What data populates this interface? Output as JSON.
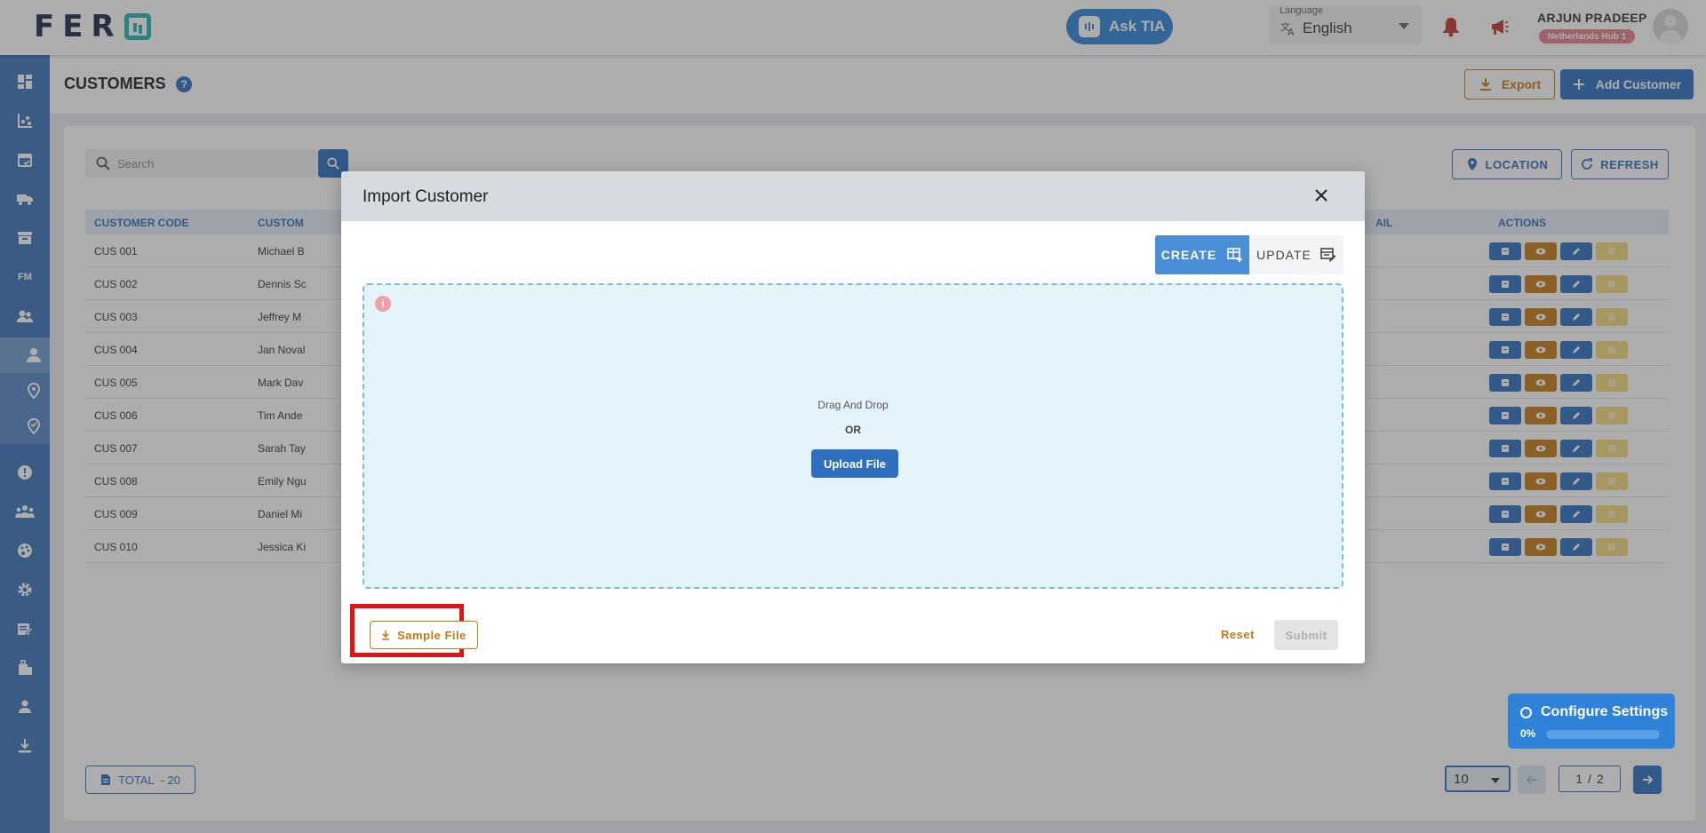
{
  "topbar": {
    "logo_text": "FER",
    "ask_tia_label": "Ask TIA",
    "language_caption": "Language",
    "language_value": "English",
    "user_name": "ARJUN PRADEEP",
    "hub_badge": "Netherlands Hub 1",
    "icons": [
      "bell-icon",
      "megaphone-icon",
      "avatar"
    ]
  },
  "sidebar": {
    "items": [
      {
        "name": "dashboard-icon"
      },
      {
        "name": "analytics-icon"
      },
      {
        "name": "calendar-icon"
      },
      {
        "name": "truck-icon"
      },
      {
        "name": "archive-icon"
      },
      {
        "name": "fm-label",
        "label": "FM"
      },
      {
        "name": "users-icon"
      },
      {
        "name": "customer-icon"
      },
      {
        "name": "location-pin-icon"
      },
      {
        "name": "location-check-icon"
      },
      {
        "name": "info-icon"
      },
      {
        "name": "group-icon"
      },
      {
        "name": "palette-icon"
      },
      {
        "name": "settings-icon"
      },
      {
        "name": "edit-note-icon"
      },
      {
        "name": "luggage-icon"
      },
      {
        "name": "person-badge-icon"
      },
      {
        "name": "download-icon"
      }
    ]
  },
  "page": {
    "title": "CUSTOMERS",
    "help": "?",
    "export_label": "Export",
    "add_label": "Add Customer"
  },
  "toolbar": {
    "search_placeholder": "Search",
    "location_label": "LOCATION",
    "refresh_label": "REFRESH"
  },
  "table": {
    "headers": {
      "code": "CUSTOMER CODE",
      "name": "CUSTOM",
      "email": "AIL",
      "actions": "ACTIONS"
    },
    "rows": [
      {
        "code": "CUS 001",
        "name": "Michael B"
      },
      {
        "code": "CUS 002",
        "name": "Dennis Sc"
      },
      {
        "code": "CUS 003",
        "name": "Jeffrey M"
      },
      {
        "code": "CUS 004",
        "name": "Jan Noval"
      },
      {
        "code": "CUS 005",
        "name": "Mark Dav"
      },
      {
        "code": "CUS 006",
        "name": "Tim Ande"
      },
      {
        "code": "CUS 007",
        "name": "Sarah Tay"
      },
      {
        "code": "CUS 008",
        "name": "Emily Ngu"
      },
      {
        "code": "CUS 009",
        "name": "Daniel Mi"
      },
      {
        "code": "CUS 010",
        "name": "Jessica Ki"
      }
    ]
  },
  "footer": {
    "total_label": "TOTAL  - 20",
    "page_size": "10",
    "page_current": "1",
    "page_sep": "/",
    "page_total": "2"
  },
  "config_widget": {
    "title": "Configure Settings",
    "percent_label": "0%",
    "progress": 0
  },
  "modal": {
    "title": "Import Customer",
    "create_label": "CREATE",
    "update_label": "UPDATE",
    "info": "i",
    "drag_text": "Drag And Drop",
    "or_text": "OR",
    "upload_label": "Upload File",
    "sample_label": "Sample File",
    "reset_label": "Reset",
    "submit_label": "Submit"
  },
  "colors": {
    "primary": "#2e6fc0",
    "accent_orange": "#c47a16",
    "highlight_red": "#e01414",
    "sidebar": "#3a72b8"
  }
}
